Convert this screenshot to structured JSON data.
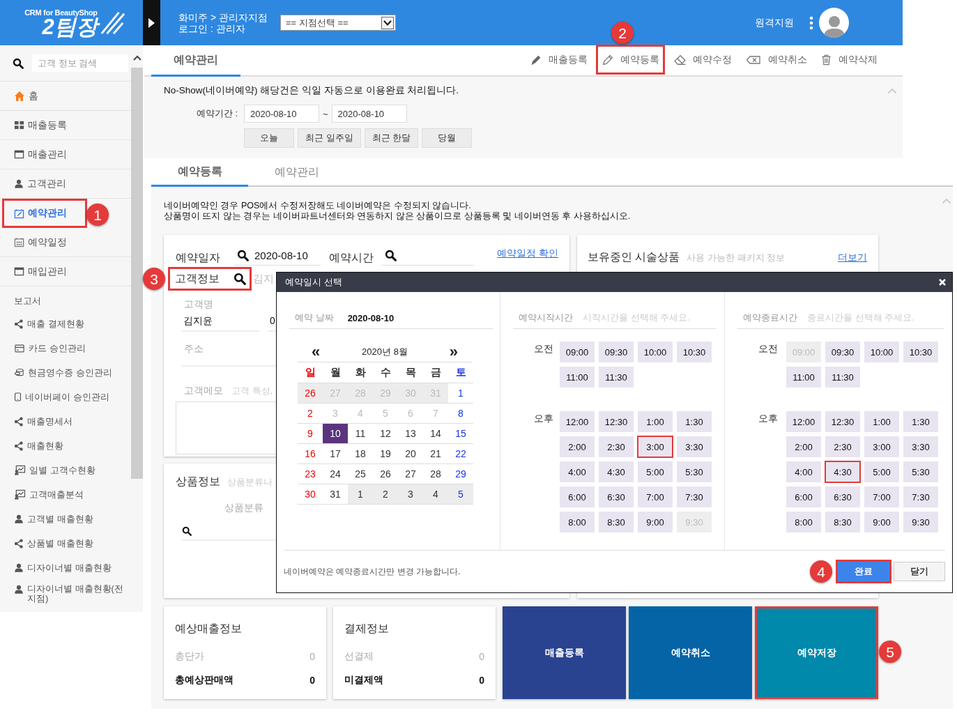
{
  "header": {
    "logo_caption": "CRM for BeautyShop",
    "logo_title": "2팀장",
    "breadcrumb": "화미주 > 관리자지점",
    "login": "로그인 : 관리자",
    "branch_select": "== 지점선택 ==",
    "remote_support": "원격지원"
  },
  "sidebar": {
    "search_placeholder": "고객 정보 검색",
    "items": [
      {
        "kind": "home",
        "label": "홈",
        "selected": false
      },
      {
        "kind": "grid",
        "label": "매출등록",
        "selected": false
      },
      {
        "kind": "window",
        "label": "매출관리",
        "selected": false
      },
      {
        "kind": "person",
        "label": "고객관리",
        "selected": false
      },
      {
        "kind": "calendar-edit",
        "label": "예약관리",
        "selected": true,
        "callout": "1"
      },
      {
        "kind": "calendar",
        "label": "예약일정",
        "selected": false
      },
      {
        "kind": "window",
        "label": "매입관리",
        "selected": false
      }
    ],
    "section_title": "보고서",
    "reports": [
      {
        "kind": "share",
        "label": "매출 결제현황"
      },
      {
        "kind": "card",
        "label": "카드 승인관리"
      },
      {
        "kind": "coins",
        "label": "현금영수증 승인관리"
      },
      {
        "kind": "phone",
        "label": "네이버페이 승인관리"
      },
      {
        "kind": "share",
        "label": "매출명세서"
      },
      {
        "kind": "share",
        "label": "매출현황"
      },
      {
        "kind": "chart",
        "label": "일별 고객수현황"
      },
      {
        "kind": "chart",
        "label": "고객매출분석"
      },
      {
        "kind": "person",
        "label": "고객별 매출현황"
      },
      {
        "kind": "share",
        "label": "상품별 매출현황"
      },
      {
        "kind": "person",
        "label": "디자이너별 매출현황"
      },
      {
        "kind": "person",
        "label": "디자이너별 매출현황(전지점)"
      }
    ]
  },
  "reservation_panel": {
    "tab": "예약관리",
    "actions": [
      {
        "kind": "pencil",
        "label": "매출등록"
      },
      {
        "kind": "pencil-outline",
        "label": "예약등록",
        "callout": "2"
      },
      {
        "kind": "eraser",
        "label": "예약수정"
      },
      {
        "kind": "backspace",
        "label": "예약취소"
      },
      {
        "kind": "trash",
        "label": "예약삭제"
      }
    ],
    "notice": "No-Show(네이버예약) 해당건은 익일 자동으로 이용완료 처리됩니다.",
    "period_label": "예약기간 :",
    "period_from": "2020-08-10",
    "period_separator": "~",
    "period_to": "2020-08-10",
    "quick_ranges": [
      "오늘",
      "최근 일주일",
      "최근 한달",
      "당월"
    ]
  },
  "registration_panel": {
    "tabs": [
      {
        "label": "예약등록",
        "selected": true
      },
      {
        "label": "예약관리",
        "selected": false
      }
    ],
    "notices": [
      "네이버예약인 경우 POS에서 수정저장해도 네이버예약은 수정되지 않습니다.",
      "상품명이 뜨지 않는 경우는 네이버파트너센터와 연동하지 않은 상품이므로 상품등록 및 네이버연동 후 사용하십시오."
    ],
    "date_label": "예약일자",
    "date_value": "2020-08-10",
    "time_label": "예약시간",
    "schedule_link": "예약일정 확인",
    "customer_label": "고객정보",
    "customer_callout": "3",
    "customer_search_value": "김지",
    "name_label": "고객명",
    "name_value": "김지윤",
    "phone_value": "0",
    "address_label": "주소",
    "memo_label": "고객메모",
    "memo_hint": "고객 특성,",
    "product_label": "상품정보",
    "product_hint": "상품분류나",
    "category_label": "상품분류",
    "package_title": "보유중인 시술상품",
    "package_hint": "사용 가능한 패키지 정보",
    "package_link": "더보기",
    "summaries": [
      {
        "title": "예상매출정보",
        "rows": [
          {
            "label": "총단가",
            "value": "0",
            "bold": false
          },
          {
            "label": "총예상판매액",
            "value": "0",
            "bold": true
          }
        ]
      },
      {
        "title": "결제정보",
        "rows": [
          {
            "label": "선결제",
            "value": "0",
            "bold": false
          },
          {
            "label": "미결제액",
            "value": "0",
            "bold": true
          }
        ]
      }
    ],
    "buttons": [
      {
        "label": "매출등록",
        "color": "#2a4390"
      },
      {
        "label": "예약취소",
        "color": "#0564a6"
      },
      {
        "label": "예약저장",
        "color": "#0089ab",
        "callout": "5"
      }
    ]
  },
  "dialog": {
    "title": "예약일시 선택",
    "date_label": "예약 날짜",
    "date_value": "2020-08-10",
    "calendar": {
      "prev": "«",
      "title": "2020년 8월",
      "next": "»",
      "weekdays": [
        "일",
        "월",
        "화",
        "수",
        "목",
        "금",
        "토"
      ],
      "weeks": [
        [
          {
            "day": "26",
            "other_month": true,
            "disabled": false,
            "selected": false
          },
          {
            "day": "27",
            "other_month": true,
            "disabled": true,
            "selected": false
          },
          {
            "day": "28",
            "other_month": true,
            "disabled": true,
            "selected": false
          },
          {
            "day": "29",
            "other_month": true,
            "disabled": true,
            "selected": false
          },
          {
            "day": "30",
            "other_month": true,
            "disabled": true,
            "selected": false
          },
          {
            "day": "31",
            "other_month": true,
            "disabled": true,
            "selected": false
          },
          {
            "day": "1",
            "other_month": false,
            "disabled": false,
            "selected": false
          }
        ],
        [
          {
            "day": "2",
            "other_month": false,
            "disabled": false,
            "selected": false
          },
          {
            "day": "3",
            "other_month": false,
            "disabled": true,
            "selected": false
          },
          {
            "day": "4",
            "other_month": false,
            "disabled": true,
            "selected": false
          },
          {
            "day": "5",
            "other_month": false,
            "disabled": true,
            "selected": false
          },
          {
            "day": "6",
            "other_month": false,
            "disabled": true,
            "selected": false
          },
          {
            "day": "7",
            "other_month": false,
            "disabled": true,
            "selected": false
          },
          {
            "day": "8",
            "other_month": false,
            "disabled": false,
            "selected": false
          }
        ],
        [
          {
            "day": "9",
            "other_month": false,
            "disabled": false,
            "selected": false
          },
          {
            "day": "10",
            "other_month": false,
            "disabled": false,
            "selected": true
          },
          {
            "day": "11",
            "other_month": false,
            "disabled": false,
            "selected": false
          },
          {
            "day": "12",
            "other_month": false,
            "disabled": false,
            "selected": false
          },
          {
            "day": "13",
            "other_month": false,
            "disabled": false,
            "selected": false
          },
          {
            "day": "14",
            "other_month": false,
            "disabled": false,
            "selected": false
          },
          {
            "day": "15",
            "other_month": false,
            "disabled": false,
            "selected": false
          }
        ],
        [
          {
            "day": "16",
            "other_month": false,
            "disabled": false,
            "selected": false
          },
          {
            "day": "17",
            "other_month": false,
            "disabled": false,
            "selected": false
          },
          {
            "day": "18",
            "other_month": false,
            "disabled": false,
            "selected": false
          },
          {
            "day": "19",
            "other_month": false,
            "disabled": false,
            "selected": false
          },
          {
            "day": "20",
            "other_month": false,
            "disabled": false,
            "selected": false
          },
          {
            "day": "21",
            "other_month": false,
            "disabled": false,
            "selected": false
          },
          {
            "day": "22",
            "other_month": false,
            "disabled": false,
            "selected": false
          }
        ],
        [
          {
            "day": "23",
            "other_month": false,
            "disabled": false,
            "selected": false
          },
          {
            "day": "24",
            "other_month": false,
            "disabled": false,
            "selected": false
          },
          {
            "day": "25",
            "other_month": false,
            "disabled": false,
            "selected": false
          },
          {
            "day": "26",
            "other_month": false,
            "disabled": false,
            "selected": false
          },
          {
            "day": "27",
            "other_month": false,
            "disabled": false,
            "selected": false
          },
          {
            "day": "28",
            "other_month": false,
            "disabled": false,
            "selected": false
          },
          {
            "day": "29",
            "other_month": false,
            "disabled": false,
            "selected": false
          }
        ],
        [
          {
            "day": "30",
            "other_month": false,
            "disabled": false,
            "selected": false
          },
          {
            "day": "31",
            "other_month": false,
            "disabled": false,
            "selected": false
          },
          {
            "day": "1",
            "other_month": true,
            "disabled": false,
            "selected": false
          },
          {
            "day": "2",
            "other_month": true,
            "disabled": false,
            "selected": false
          },
          {
            "day": "3",
            "other_month": true,
            "disabled": false,
            "selected": false
          },
          {
            "day": "4",
            "other_month": true,
            "disabled": false,
            "selected": false
          },
          {
            "day": "5",
            "other_month": true,
            "disabled": false,
            "selected": false
          }
        ]
      ]
    },
    "time_columns": [
      {
        "label": "예약시작시간",
        "hint": "시작시간을 선택해 주세요.",
        "groups": [
          {
            "label": "오전",
            "slots": [
              {
                "time": "09:00",
                "disabled": false,
                "selected": false
              },
              {
                "time": "09:30",
                "disabled": false,
                "selected": false
              },
              {
                "time": "10:00",
                "disabled": false,
                "selected": false
              },
              {
                "time": "10:30",
                "disabled": false,
                "selected": false
              },
              {
                "time": "11:00",
                "disabled": false,
                "selected": false
              },
              {
                "time": "11:30",
                "disabled": false,
                "selected": false
              }
            ]
          },
          {
            "label": "오후",
            "slots": [
              {
                "time": "12:00",
                "disabled": false,
                "selected": false
              },
              {
                "time": "12:30",
                "disabled": false,
                "selected": false
              },
              {
                "time": "1:00",
                "disabled": false,
                "selected": false
              },
              {
                "time": "1:30",
                "disabled": false,
                "selected": false
              },
              {
                "time": "2:00",
                "disabled": false,
                "selected": false
              },
              {
                "time": "2:30",
                "disabled": false,
                "selected": false
              },
              {
                "time": "3:00",
                "disabled": false,
                "selected": true
              },
              {
                "time": "3:30",
                "disabled": false,
                "selected": false
              },
              {
                "time": "4:00",
                "disabled": false,
                "selected": false
              },
              {
                "time": "4:30",
                "disabled": false,
                "selected": false
              },
              {
                "time": "5:00",
                "disabled": false,
                "selected": false
              },
              {
                "time": "5:30",
                "disabled": false,
                "selected": false
              },
              {
                "time": "6:00",
                "disabled": false,
                "selected": false
              },
              {
                "time": "6:30",
                "disabled": false,
                "selected": false
              },
              {
                "time": "7:00",
                "disabled": false,
                "selected": false
              },
              {
                "time": "7:30",
                "disabled": false,
                "selected": false
              },
              {
                "time": "8:00",
                "disabled": false,
                "selected": false
              },
              {
                "time": "8:30",
                "disabled": false,
                "selected": false
              },
              {
                "time": "9:00",
                "disabled": false,
                "selected": false
              },
              {
                "time": "9:30",
                "disabled": true,
                "selected": false
              }
            ]
          }
        ]
      },
      {
        "label": "예약종료시간",
        "hint": "종료시간을 선택해 주세요.",
        "groups": [
          {
            "label": "오전",
            "slots": [
              {
                "time": "09:00",
                "disabled": true,
                "selected": false
              },
              {
                "time": "09:30",
                "disabled": false,
                "selected": false
              },
              {
                "time": "10:00",
                "disabled": false,
                "selected": false
              },
              {
                "time": "10:30",
                "disabled": false,
                "selected": false
              },
              {
                "time": "11:00",
                "disabled": false,
                "selected": false
              },
              {
                "time": "11:30",
                "disabled": false,
                "selected": false
              }
            ]
          },
          {
            "label": "오후",
            "slots": [
              {
                "time": "12:00",
                "disabled": false,
                "selected": false
              },
              {
                "time": "12:30",
                "disabled": false,
                "selected": false
              },
              {
                "time": "1:00",
                "disabled": false,
                "selected": false
              },
              {
                "time": "1:30",
                "disabled": false,
                "selected": false
              },
              {
                "time": "2:00",
                "disabled": false,
                "selected": false
              },
              {
                "time": "2:30",
                "disabled": false,
                "selected": false
              },
              {
                "time": "3:00",
                "disabled": false,
                "selected": false
              },
              {
                "time": "3:30",
                "disabled": false,
                "selected": false
              },
              {
                "time": "4:00",
                "disabled": false,
                "selected": false
              },
              {
                "time": "4:30",
                "disabled": false,
                "selected": true
              },
              {
                "time": "5:00",
                "disabled": false,
                "selected": false
              },
              {
                "time": "5:30",
                "disabled": false,
                "selected": false
              },
              {
                "time": "6:00",
                "disabled": false,
                "selected": false
              },
              {
                "time": "6:30",
                "disabled": false,
                "selected": false
              },
              {
                "time": "7:00",
                "disabled": false,
                "selected": false
              },
              {
                "time": "7:30",
                "disabled": false,
                "selected": false
              },
              {
                "time": "8:00",
                "disabled": false,
                "selected": false
              },
              {
                "time": "8:30",
                "disabled": false,
                "selected": false
              },
              {
                "time": "9:00",
                "disabled": false,
                "selected": false
              },
              {
                "time": "9:30",
                "disabled": false,
                "selected": false
              }
            ]
          }
        ]
      }
    ],
    "footer_note": "네이버예약은 예약종료시간만 변경 가능합니다.",
    "buttons": [
      {
        "kind": "primary",
        "label": "완료",
        "callout": "4"
      },
      {
        "kind": "secondary",
        "label": "닫기"
      }
    ]
  }
}
